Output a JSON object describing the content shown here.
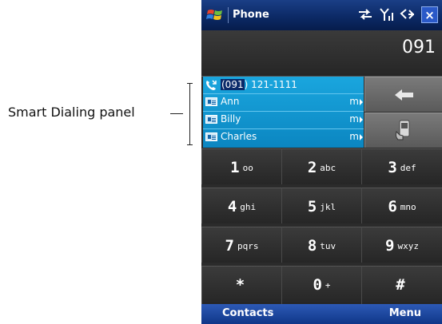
{
  "callout": {
    "label": "Smart Dialing panel"
  },
  "titlebar": {
    "title": "Phone",
    "close_label": "×"
  },
  "display": {
    "dialed_number": "091"
  },
  "smart_dialing": {
    "call_entry": {
      "highlight": "(091",
      "rest": ") 121-1111"
    },
    "contacts": [
      {
        "name": "Ann",
        "type": "m"
      },
      {
        "name": "Billy",
        "type": "m"
      },
      {
        "name": "Charles",
        "type": "m"
      }
    ]
  },
  "keypad": [
    {
      "digit": "1",
      "letters": "oo"
    },
    {
      "digit": "2",
      "letters": "abc"
    },
    {
      "digit": "3",
      "letters": "def"
    },
    {
      "digit": "4",
      "letters": "ghi"
    },
    {
      "digit": "5",
      "letters": "jkl"
    },
    {
      "digit": "6",
      "letters": "mno"
    },
    {
      "digit": "7",
      "letters": "pqrs"
    },
    {
      "digit": "8",
      "letters": "tuv"
    },
    {
      "digit": "9",
      "letters": "wxyz"
    },
    {
      "digit": "*",
      "letters": ""
    },
    {
      "digit": "0",
      "letters": "+"
    },
    {
      "digit": "#",
      "letters": ""
    }
  ],
  "softkeys": {
    "left": "Contacts",
    "right": "Menu"
  },
  "icons": {
    "start": "windows-flag-icon",
    "connectivity": "sync-arrows-icon",
    "signal": "signal-strength-icon",
    "volume": "speaker-volume-icon",
    "backspace": "backspace-arrow-icon",
    "talk": "phone-handset-icon"
  }
}
